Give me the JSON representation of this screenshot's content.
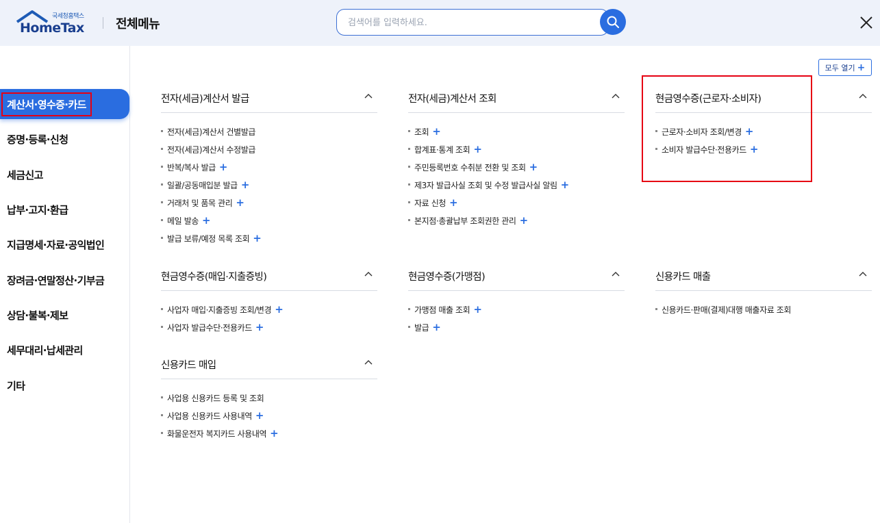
{
  "header": {
    "logo_sub": "국세청홈택스",
    "logo_main": "HomeTax",
    "title": "전체메뉴",
    "search_placeholder": "검색어를 입력하세요.",
    "accent": "#2a6de0"
  },
  "expand_all_label": "모두 열기",
  "sidebar": {
    "items": [
      {
        "label": "계산서·영수증·카드",
        "active": true
      },
      {
        "label": "증명·등록·신청"
      },
      {
        "label": "세금신고"
      },
      {
        "label": "납부·고지·환급"
      },
      {
        "label": "지급명세·자료·공익법인"
      },
      {
        "label": "장려금·연말정산·기부금"
      },
      {
        "label": "상담·불복·제보"
      },
      {
        "label": "세무대리·납세관리"
      },
      {
        "label": "기타"
      }
    ]
  },
  "sections": [
    {
      "title": "전자(세금)계산서 발급",
      "items": [
        {
          "label": "전자(세금)계산서 건별발급",
          "plus": false
        },
        {
          "label": "전자(세금)계산서 수정발급",
          "plus": false
        },
        {
          "label": "반복/복사 발급",
          "plus": true
        },
        {
          "label": "일괄/공동매입분 발급",
          "plus": true
        },
        {
          "label": "거래처 및 품목 관리",
          "plus": true
        },
        {
          "label": "메일 발송",
          "plus": true
        },
        {
          "label": "발급 보류/예정 목록 조회",
          "plus": true
        }
      ]
    },
    {
      "title": "전자(세금)계산서 조회",
      "items": [
        {
          "label": "조회",
          "plus": true
        },
        {
          "label": "합계표·통계 조회",
          "plus": true
        },
        {
          "label": "주민등록번호 수취분 전환 및 조회",
          "plus": true
        },
        {
          "label": "제3자 발급사실 조회 및 수정 발급사실 알림",
          "plus": true
        },
        {
          "label": "자료 신청",
          "plus": true
        },
        {
          "label": "본지점·총괄납부 조회권한 관리",
          "plus": true
        }
      ]
    },
    {
      "title": "현금영수증(근로자·소비자)",
      "items": [
        {
          "label": "근로자·소비자 조회/변경",
          "plus": true
        },
        {
          "label": "소비자 발급수단·전용카드",
          "plus": true
        }
      ]
    },
    {
      "title": "현금영수증(매입·지출증빙)",
      "items": [
        {
          "label": "사업자 매입·지출증빙 조회/변경",
          "plus": true
        },
        {
          "label": "사업자 발급수단·전용카드",
          "plus": true
        }
      ]
    },
    {
      "title": "현금영수증(가맹점)",
      "items": [
        {
          "label": "가맹점 매출 조회",
          "plus": true
        },
        {
          "label": "발급",
          "plus": true
        }
      ]
    },
    {
      "title": "신용카드 매출",
      "items": [
        {
          "label": "신용카드·판매(결제)대행 매출자료 조회",
          "plus": false
        }
      ]
    },
    {
      "title": "신용카드 매입",
      "items": [
        {
          "label": "사업용 신용카드 등록 및 조회",
          "plus": false
        },
        {
          "label": "사업용 신용카드 사용내역",
          "plus": true
        },
        {
          "label": "화물운전자 복지카드 사용내역",
          "plus": true
        }
      ]
    }
  ]
}
